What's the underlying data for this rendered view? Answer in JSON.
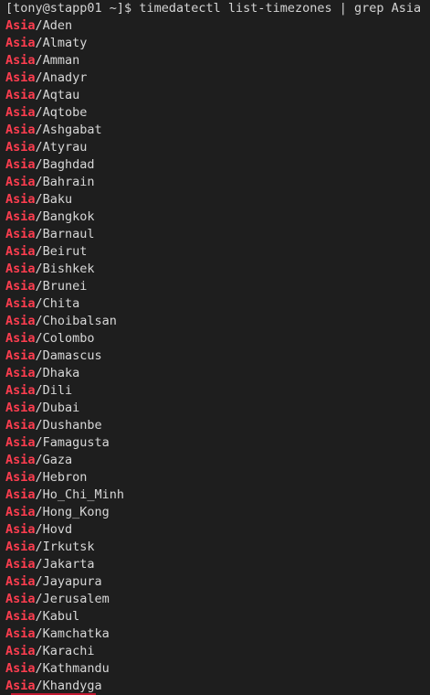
{
  "terminal": {
    "prompt": "[tony@stapp01 ~]$ ",
    "command": "timedatectl list-timezones | grep Asia",
    "match": "Asia",
    "lines": [
      "/Aden",
      "/Almaty",
      "/Amman",
      "/Anadyr",
      "/Aqtau",
      "/Aqtobe",
      "/Ashgabat",
      "/Atyrau",
      "/Baghdad",
      "/Bahrain",
      "/Baku",
      "/Bangkok",
      "/Barnaul",
      "/Beirut",
      "/Bishkek",
      "/Brunei",
      "/Chita",
      "/Choibalsan",
      "/Colombo",
      "/Damascus",
      "/Dhaka",
      "/Dili",
      "/Dubai",
      "/Dushanbe",
      "/Famagusta",
      "/Gaza",
      "/Hebron",
      "/Ho_Chi_Minh",
      "/Hong_Kong",
      "/Hovd",
      "/Irkutsk",
      "/Jakarta",
      "/Jayapura",
      "/Jerusalem",
      "/Kabul",
      "/Kamchatka",
      "/Karachi",
      "/Kathmandu",
      "/Khandyga"
    ],
    "colors": {
      "background": "#1e1e1e",
      "text": "#d7d7d7",
      "match": "#ff3d4f"
    }
  }
}
